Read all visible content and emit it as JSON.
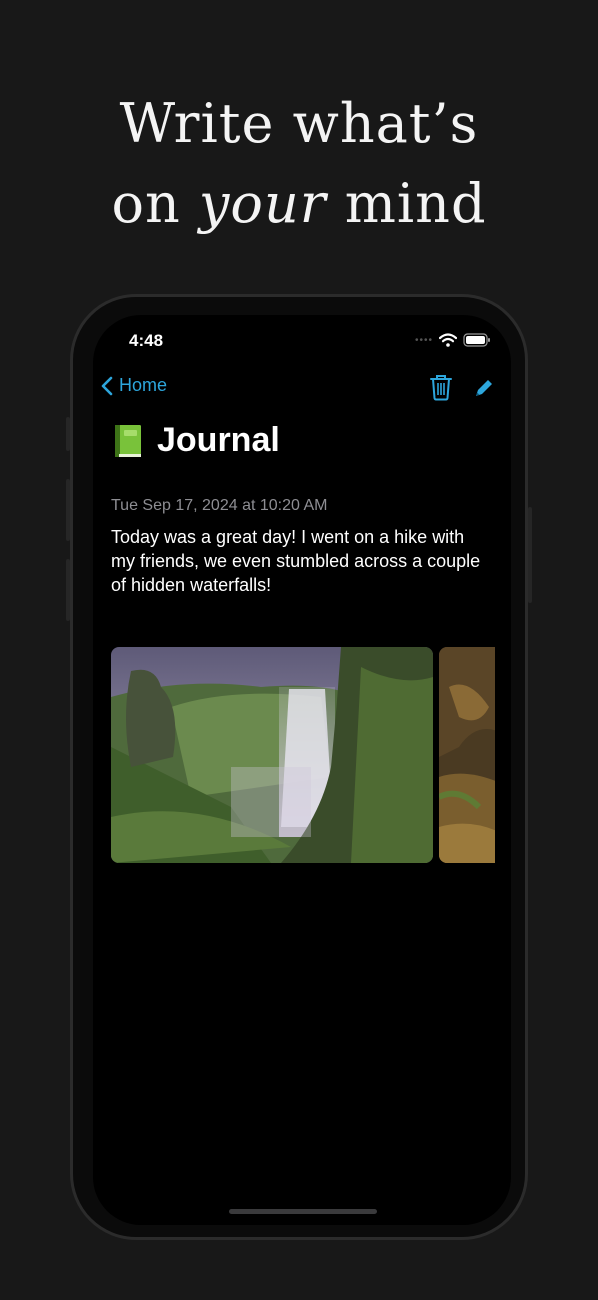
{
  "headline": {
    "line1": "Write what’s",
    "line2_prefix": "on ",
    "line2_emphasis": "your",
    "line2_suffix": " mind"
  },
  "status_bar": {
    "time": "4:48"
  },
  "nav": {
    "back_label": "Home"
  },
  "entry": {
    "title": "Journal",
    "title_icon": "green-book-icon",
    "date": "Tue Sep 17, 2024 at 10:20 AM",
    "body": "Today was a great day! I went on a hike with my friends, we even stumbled across a couple of hidden waterfalls!"
  },
  "colors": {
    "accent": "#2da6dc",
    "background": "#181818",
    "screen": "#000000",
    "secondary_text": "#8e8e93"
  }
}
